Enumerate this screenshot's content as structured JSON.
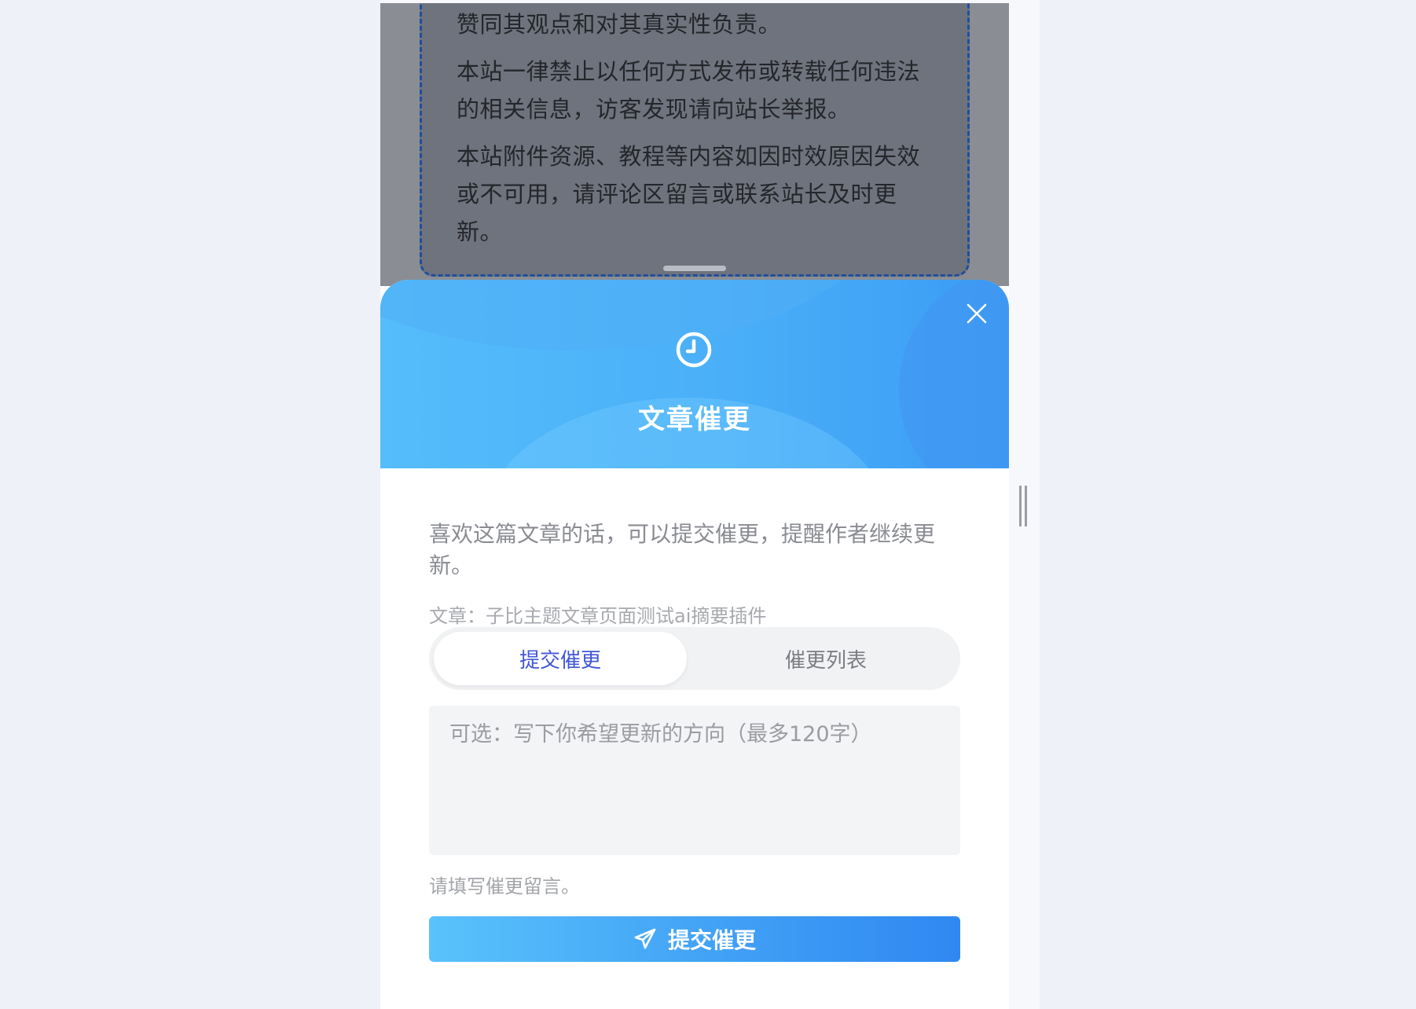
{
  "article": {
    "paragraphs": [
      "赞同其观点和对其真实性负责。",
      "本站一律禁止以任何方式发布或转载任何违法的相关信息，访客发现请向站长举报。",
      "本站附件资源、教程等内容如因时效原因失效或不可用，请评论区留言或联系站长及时更新。"
    ]
  },
  "sheet": {
    "title": "文章催更",
    "intro": "喜欢这篇文章的话，可以提交催更，提醒作者继续更新。",
    "article_ref": "文章：子比主题文章页面测试ai摘要插件",
    "tabs": [
      {
        "label": "提交催更",
        "active": true
      },
      {
        "label": "催更列表",
        "active": false
      }
    ],
    "textarea": {
      "placeholder": "可选：写下你希望更新的方向（最多120字）",
      "value": ""
    },
    "hint": "请填写催更留言。",
    "submit_label": "提交催更"
  },
  "icons": {
    "close": "close-icon",
    "clock": "clock-icon",
    "send": "paper-plane-icon"
  },
  "colors": {
    "header_start": "#55bdfb",
    "header_end": "#3b9cf4",
    "tab_active_text": "#3f56d6"
  }
}
